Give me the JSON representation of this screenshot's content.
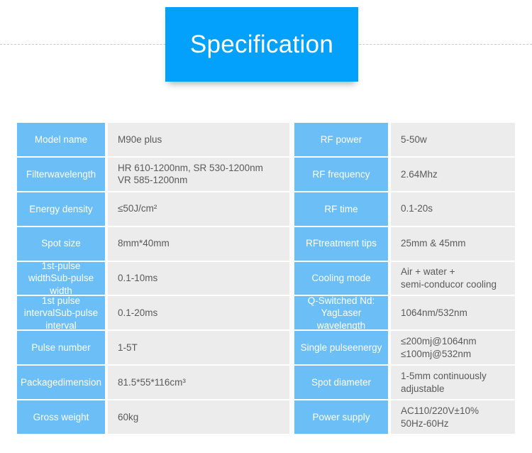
{
  "header": {
    "banner_title": "Specification"
  },
  "table": {
    "rows": [
      {
        "left": {
          "label": "Model name",
          "value_lines": [
            "M90e plus"
          ]
        },
        "right": {
          "label": "RF power",
          "value_lines": [
            "5-50w"
          ]
        }
      },
      {
        "left": {
          "label_lines": [
            "Filter",
            "wavelength"
          ],
          "value_lines": [
            "HR 610-1200nm, SR 530-1200nm",
            "VR 585-1200nm"
          ]
        },
        "right": {
          "label": "RF frequency",
          "value_lines": [
            "2.64Mhz"
          ]
        }
      },
      {
        "left": {
          "label": "Energy density",
          "value_lines": [
            "≤50J/cm²"
          ]
        },
        "right": {
          "label": "RF time",
          "value_lines": [
            "0.1-20s"
          ]
        }
      },
      {
        "left": {
          "label": "Spot size",
          "value_lines": [
            "8mm*40mm"
          ]
        },
        "right": {
          "label_lines": [
            "RF",
            "treatment tips"
          ],
          "value_lines": [
            "25mm & 45mm"
          ]
        }
      },
      {
        "left": {
          "label_lines": [
            "1st-pulse width",
            "Sub-pulse width"
          ],
          "value_lines": [
            "0.1-10ms"
          ]
        },
        "right": {
          "label": "Cooling mode",
          "value_lines": [
            "Air + water +",
            "semi-conducor cooling"
          ]
        }
      },
      {
        "left": {
          "label_lines": [
            "1st pulse interval",
            "Sub-pulse interval"
          ],
          "value_lines": [
            "0.1-20ms"
          ]
        },
        "right": {
          "label_lines": [
            "Q-Switched Nd: Yag",
            "Laser wavelength"
          ],
          "value_lines": [
            "1064nm/532nm"
          ]
        }
      },
      {
        "left": {
          "label": "Pulse number",
          "value_lines": [
            "1-5T"
          ]
        },
        "right": {
          "label_lines": [
            "Single pulse",
            "energy"
          ],
          "value_lines": [
            "≤200mj@1064nm",
            "≤100mj@532nm"
          ]
        }
      },
      {
        "left": {
          "label_lines": [
            "Package",
            "dimension"
          ],
          "value_lines": [
            "81.5*55*116cm³"
          ]
        },
        "right": {
          "label": "Spot diameter",
          "value_lines": [
            "1-5mm continuously",
            "adjustable"
          ]
        }
      },
      {
        "left": {
          "label": "Gross weight",
          "value_lines": [
            "60kg"
          ]
        },
        "right": {
          "label": "Power supply",
          "value_lines": [
            "AC110/220V±10%",
            "50Hz-60Hz"
          ]
        }
      }
    ]
  },
  "colors": {
    "banner_blue": "#03A0FC",
    "label_blue": "#6CBEF7",
    "value_gray": "#ECECEC",
    "value_text": "#5A5A5A",
    "page_background": "#FFFFFF",
    "rule_gray": "#C9C9C9"
  }
}
